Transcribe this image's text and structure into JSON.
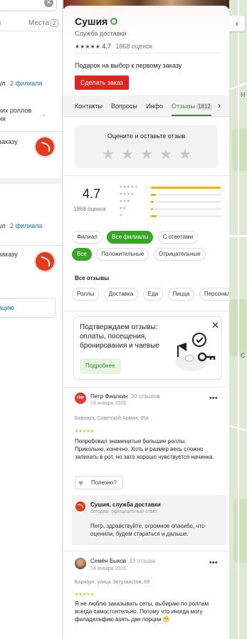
{
  "left_panel": {
    "tab_a": "ы",
    "tab_b": "Места",
    "tab_b_count": "2",
    "row1_text": "ул",
    "row1_link": "2 филиала",
    "row2_text": "ких роллов",
    "row2_text2": "ия",
    "row3_text": "заказу",
    "row4_text": "ул",
    "row4_link": "2 филиала",
    "row5_text": "заказу",
    "bottom_link": "ацию"
  },
  "card": {
    "title": "Сушия",
    "subtitle": "Служба доставки",
    "stars": "★★★★★",
    "rating": "4.7",
    "rating_count": "1868 оценок",
    "gift": "Подарок на выбор к первому заказу",
    "order_button": "Сделать заказ"
  },
  "tabs": [
    {
      "label": "Контакты"
    },
    {
      "label": "Вопросы"
    },
    {
      "label": "Инфо"
    },
    {
      "label": "Отзывы",
      "badge": "1812"
    }
  ],
  "rate_box": {
    "prompt": "Оцените и оставьте отзыв",
    "star": "★"
  },
  "summary": {
    "rating": "4.7",
    "count": "1868 оценок",
    "distribution": [
      {
        "stars": "★★★★★",
        "fraction": 0.99
      },
      {
        "stars": "★★★★",
        "fraction": 0.07
      },
      {
        "stars": "★★★",
        "fraction": 0.04
      },
      {
        "stars": "★★",
        "fraction": 0.03
      },
      {
        "stars": "★",
        "fraction": 0.08
      }
    ]
  },
  "filters": {
    "branch": [
      "Филиал",
      "Все филиалы",
      "С ответами"
    ],
    "sentiment": [
      "Все",
      "Положительные",
      "Отрицательные"
    ],
    "all_reviews": "Все отзывы",
    "topics": [
      "Роллы",
      "Доставка",
      "Еда",
      "Пицца",
      "Персонал"
    ]
  },
  "promo": {
    "text": "Подтверждаем отзывы: оплаты, посещения, бронирования и чаевые",
    "button": "Подробнее",
    "close": "✕"
  },
  "reviews": [
    {
      "avatar_text": "ПФ",
      "name": "Петр Фиалкин",
      "count": "30 отзывов",
      "date": "14 января 2026",
      "address": "Барнаул, Советской Армии, 95а",
      "stars": "★★★★★",
      "text": "Попробовал знаменитые большие роллы. Прикольно, конечно. Хоть и размер весь сложно запихать в рот, но зато хорошо чувствуется начинка.",
      "useful": "Полезно?"
    },
    {
      "name": "Семён Быков",
      "count": "33 отзыва",
      "date": "14 января 2026",
      "address": "Барнаул, улица Энтузиастов, 69",
      "stars": "★★★★★",
      "text": "Я не люблю заказывать сеты, выбираю по роллам всегда самостоятельно. Потому что иногда могу филадельфию взять две порции 😁"
    }
  ],
  "answer": {
    "name": "Сушия, служба доставки",
    "meta": "сегодня, официальный ответ",
    "text": "Петр, здравствуйте, огромное спасибо, что оценили, будем стараться и дальше."
  },
  "map": {
    "label_h": "Н",
    "label_c": "С"
  },
  "colors": {
    "accent_green": "#3aa528",
    "order_red": "#e0241e",
    "star_yellow": "#f5b400"
  }
}
